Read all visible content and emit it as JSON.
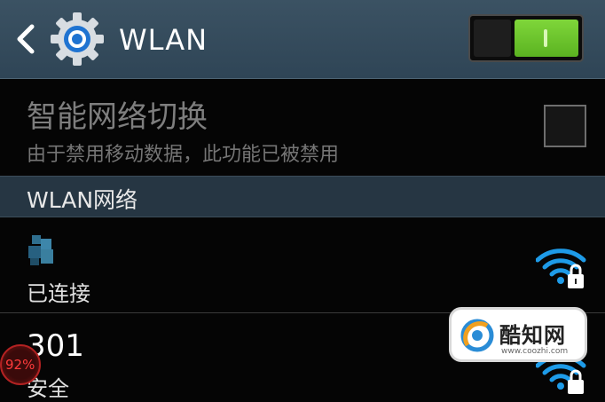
{
  "header": {
    "title": "WLAN",
    "back_icon": "chevron-left-icon",
    "settings_icon": "gear-icon",
    "toggle": {
      "state": "on",
      "on_color": "#6cc52d"
    }
  },
  "smart_switch": {
    "title": "智能网络切换",
    "subtitle": "由于禁用移动数据，此功能已被禁用",
    "checked": false
  },
  "section": {
    "title": "WLAN网络"
  },
  "networks": [
    {
      "ssid": "",
      "status": "已连接",
      "icon": "wifi-locked-icon"
    },
    {
      "ssid": "301",
      "status": "安全",
      "icon": "wifi-locked-icon"
    }
  ],
  "overlay": {
    "meter": "92%",
    "accent": "#d62a2a"
  },
  "watermark": {
    "name": "酷知网",
    "url": "www.coozhi.com",
    "accent": "#2a8cd6"
  }
}
